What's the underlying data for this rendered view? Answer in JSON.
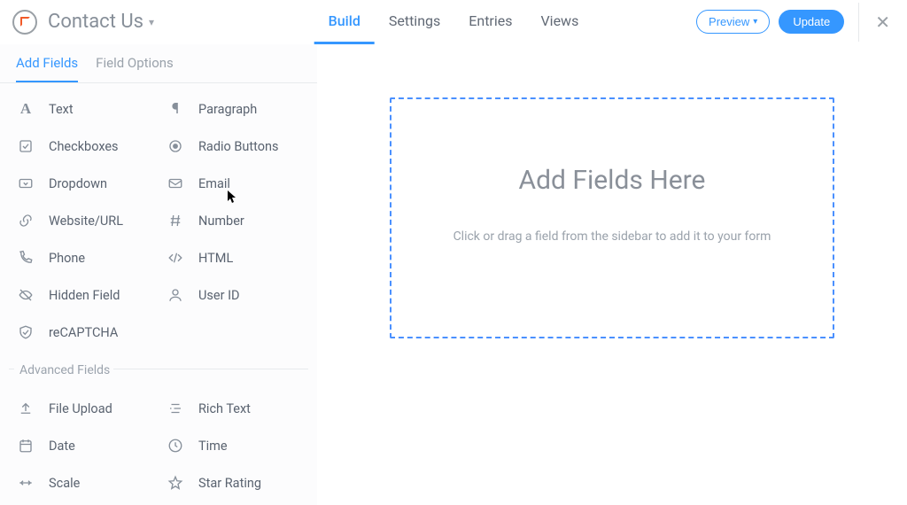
{
  "header": {
    "form_name": "Contact Us",
    "tabs": {
      "build": "Build",
      "settings": "Settings",
      "entries": "Entries",
      "views": "Views"
    },
    "preview": "Preview",
    "update": "Update"
  },
  "sidebar": {
    "tabs": {
      "add_fields": "Add Fields",
      "field_options": "Field Options"
    },
    "basic": {
      "text": "Text",
      "paragraph": "Paragraph",
      "checkboxes": "Checkboxes",
      "radio": "Radio Buttons",
      "dropdown": "Dropdown",
      "email": "Email",
      "website": "Website/URL",
      "number": "Number",
      "phone": "Phone",
      "html": "HTML",
      "hidden": "Hidden Field",
      "userid": "User ID",
      "recaptcha": "reCAPTCHA"
    },
    "section_advanced": "Advanced Fields",
    "advanced": {
      "fileupload": "File Upload",
      "richtext": "Rich Text",
      "date": "Date",
      "time": "Time",
      "scale": "Scale",
      "star": "Star Rating"
    }
  },
  "canvas": {
    "title": "Add Fields Here",
    "subtitle": "Click or drag a field from the sidebar to add it to your form"
  }
}
